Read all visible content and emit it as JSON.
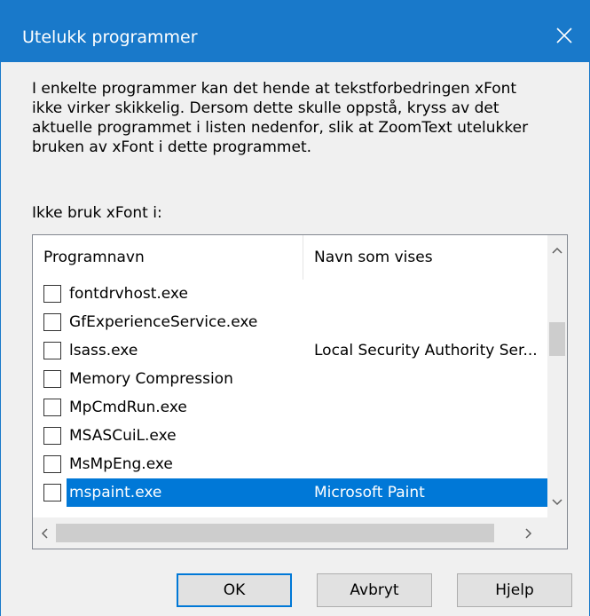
{
  "dialog": {
    "title": "Utelukk programmer",
    "close_icon": "close-icon",
    "description": "I enkelte programmer kan det hende at tekstforbedringen xFont\nikke virker skikkelig. Dersom dette skulle oppstå, kryss av det\naktuelle programmet i listen nedenfor, slik at ZoomText utelukker\nbruken av xFont i dette programmet.",
    "list_label": "Ikke bruk xFont i:"
  },
  "list": {
    "columns": [
      "Programnavn",
      "Navn som vises"
    ],
    "rows": [
      {
        "name": "fontdrvhost.exe",
        "display": "",
        "checked": false,
        "selected": false
      },
      {
        "name": "GfExperienceService.exe",
        "display": "",
        "checked": false,
        "selected": false
      },
      {
        "name": "lsass.exe",
        "display": "Local Security Authority Ser...",
        "checked": false,
        "selected": false
      },
      {
        "name": "Memory Compression",
        "display": "",
        "checked": false,
        "selected": false
      },
      {
        "name": "MpCmdRun.exe",
        "display": "",
        "checked": false,
        "selected": false
      },
      {
        "name": "MSASCuiL.exe",
        "display": "",
        "checked": false,
        "selected": false
      },
      {
        "name": "MsMpEng.exe",
        "display": "",
        "checked": false,
        "selected": false
      },
      {
        "name": "mspaint.exe",
        "display": "Microsoft Paint",
        "checked": false,
        "selected": true
      }
    ]
  },
  "buttons": {
    "ok": "OK",
    "cancel": "Avbryt",
    "help": "Hjelp"
  },
  "colors": {
    "titlebar": "#1979ca",
    "selection": "#0078d7",
    "window_bg": "#f0f0f0"
  }
}
